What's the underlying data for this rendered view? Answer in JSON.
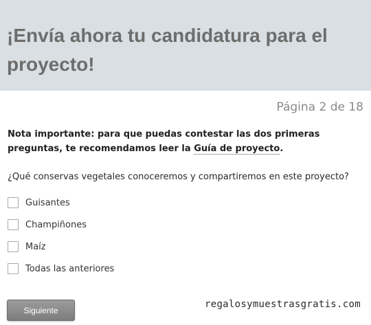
{
  "header": {
    "title": "¡Envía ahora tu candidatura para el proyecto!"
  },
  "pagination": {
    "text": "Página 2 de 18"
  },
  "note": {
    "prefix": "Nota importante: para que puedas contestar las dos primeras preguntas, te recomendamos leer la ",
    "link_text": "Guía de proyecto",
    "suffix": "."
  },
  "question": {
    "text": "¿Qué conservas vegetales conoceremos y compartiremos en este proyecto?",
    "options": [
      {
        "label": "Guisantes",
        "checked": false
      },
      {
        "label": "Champiñones",
        "checked": false
      },
      {
        "label": "Maíz",
        "checked": false
      },
      {
        "label": "Todas las anteriores",
        "checked": false
      }
    ]
  },
  "actions": {
    "next_label": "Siguiente"
  },
  "watermark": {
    "text": "regalosymuestrasgratis.com"
  },
  "colors": {
    "header_bg": "#d9dfe2",
    "title_text": "#6d6d6d",
    "button_bg": "#8a8a8a"
  }
}
